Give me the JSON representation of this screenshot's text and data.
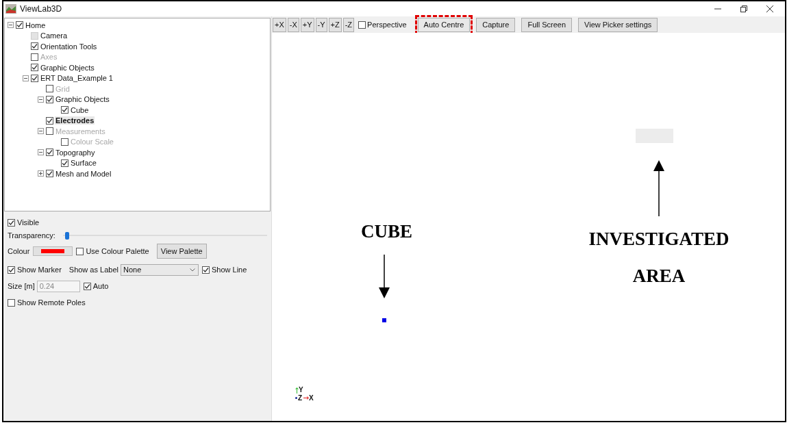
{
  "window": {
    "title": "ViewLab3D"
  },
  "tree": [
    {
      "label": "Home",
      "checked": true,
      "disabled": false,
      "checkbox_disabled": false,
      "selected": false,
      "expanded": true,
      "children": [
        {
          "label": "Camera",
          "checked": false,
          "disabled": false,
          "checkbox_disabled": true,
          "selected": false
        },
        {
          "label": "Orientation Tools",
          "checked": true,
          "disabled": false,
          "checkbox_disabled": false,
          "selected": false
        },
        {
          "label": "Axes",
          "checked": false,
          "disabled": true,
          "checkbox_disabled": false,
          "selected": false
        },
        {
          "label": "Graphic Objects",
          "checked": true,
          "disabled": false,
          "checkbox_disabled": false,
          "selected": false
        },
        {
          "label": "ERT Data_Example 1",
          "checked": true,
          "disabled": false,
          "checkbox_disabled": false,
          "selected": false,
          "expanded": true,
          "children": [
            {
              "label": "Grid",
              "checked": false,
              "disabled": true,
              "checkbox_disabled": false,
              "selected": false
            },
            {
              "label": "Graphic Objects",
              "checked": true,
              "disabled": false,
              "checkbox_disabled": false,
              "selected": false,
              "expanded": true,
              "children": [
                {
                  "label": "Cube",
                  "checked": true,
                  "disabled": false,
                  "checkbox_disabled": false,
                  "selected": false
                }
              ]
            },
            {
              "label": "Electrodes",
              "checked": true,
              "disabled": false,
              "checkbox_disabled": false,
              "selected": true
            },
            {
              "label": "Measurements",
              "checked": false,
              "disabled": true,
              "checkbox_disabled": false,
              "selected": false,
              "expanded": true,
              "children": [
                {
                  "label": "Colour Scale",
                  "checked": false,
                  "disabled": true,
                  "checkbox_disabled": false,
                  "selected": false
                }
              ]
            },
            {
              "label": "Topography",
              "checked": true,
              "disabled": false,
              "checkbox_disabled": false,
              "selected": false,
              "expanded": true,
              "children": [
                {
                  "label": "Surface",
                  "checked": true,
                  "disabled": false,
                  "checkbox_disabled": false,
                  "selected": false
                }
              ]
            },
            {
              "label": "Mesh and Model",
              "checked": true,
              "disabled": false,
              "checkbox_disabled": false,
              "selected": false,
              "expanded": false
            }
          ]
        }
      ]
    }
  ],
  "properties": {
    "visible": {
      "label": "Visible",
      "checked": true
    },
    "transparency": {
      "label": "Transparency:",
      "level": 0.01
    },
    "colour": {
      "label": "Colour",
      "color": "#ff0000"
    },
    "use_colour_palette": {
      "label": "Use Colour Palette",
      "checked": false
    },
    "view_palette_button": "View Palette",
    "show_marker": {
      "label": "Show Marker",
      "checked": true
    },
    "show_as_label": {
      "label": "Show as Label",
      "value": "None"
    },
    "show_line": {
      "label": "Show Line",
      "checked": true
    },
    "size": {
      "label": "Size [m]",
      "value": "0.24"
    },
    "auto": {
      "label": "Auto",
      "checked": true
    },
    "show_remote_poles": {
      "label": "Show Remote Poles",
      "checked": false
    }
  },
  "toolbar": {
    "view_buttons": [
      "+X",
      "-X",
      "+Y",
      "-Y",
      "+Z",
      "-Z"
    ],
    "perspective": {
      "label": "Perspective",
      "checked": false
    },
    "buttons": [
      {
        "label": "Auto Centre",
        "highlighted": true
      },
      {
        "label": "Capture",
        "highlighted": false
      },
      {
        "label": "Full Screen",
        "highlighted": false
      },
      {
        "label": "View Picker settings",
        "highlighted": false
      }
    ]
  },
  "viewport": {
    "annotations": [
      {
        "text": "CUBE"
      },
      {
        "text": "INVESTIGATED AREA"
      }
    ],
    "axes": {
      "y": "Y",
      "z": "Z",
      "x": "X"
    }
  }
}
